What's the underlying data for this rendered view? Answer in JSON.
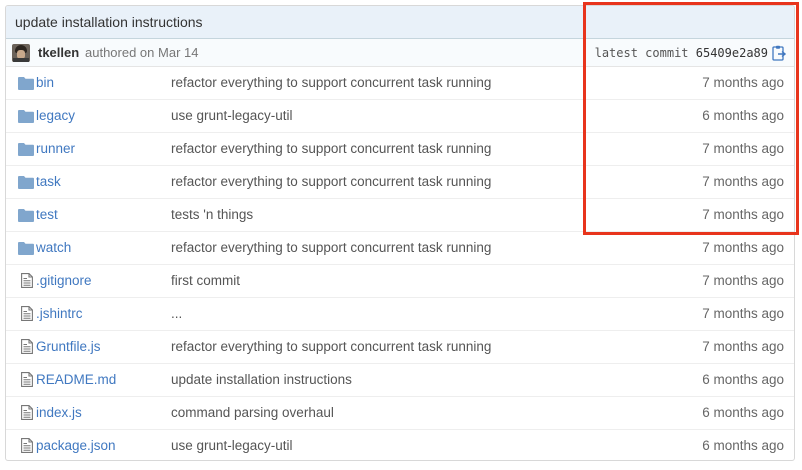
{
  "latest_commit": {
    "message": "update installation instructions",
    "author": "tkellen",
    "authored_text": "authored on Mar 14",
    "sha_label": "latest commit",
    "sha": "65409e2a89"
  },
  "files": [
    {
      "type": "folder",
      "icon": "folder-icon",
      "name": "bin",
      "message": "refactor everything to support concurrent task running",
      "age": "7 months ago"
    },
    {
      "type": "folder",
      "icon": "folder-icon",
      "name": "legacy",
      "message": "use grunt-legacy-util",
      "age": "6 months ago"
    },
    {
      "type": "folder",
      "icon": "folder-icon",
      "name": "runner",
      "message": "refactor everything to support concurrent task running",
      "age": "7 months ago"
    },
    {
      "type": "folder",
      "icon": "folder-icon",
      "name": "task",
      "message": "refactor everything to support concurrent task running",
      "age": "7 months ago"
    },
    {
      "type": "folder",
      "icon": "folder-icon",
      "name": "test",
      "message": "tests 'n things",
      "age": "7 months ago"
    },
    {
      "type": "folder",
      "icon": "folder-icon",
      "name": "watch",
      "message": "refactor everything to support concurrent task running",
      "age": "7 months ago"
    },
    {
      "type": "file",
      "icon": "file-icon",
      "name": ".gitignore",
      "message": "first commit",
      "age": "7 months ago"
    },
    {
      "type": "file",
      "icon": "file-icon",
      "name": ".jshintrc",
      "message": "...",
      "age": "7 months ago"
    },
    {
      "type": "file",
      "icon": "file-icon",
      "name": "Gruntfile.js",
      "message": "refactor everything to support concurrent task running",
      "age": "7 months ago"
    },
    {
      "type": "file",
      "icon": "file-icon",
      "name": "README.md",
      "message": "update installation instructions",
      "age": "6 months ago"
    },
    {
      "type": "file",
      "icon": "file-icon",
      "name": "index.js",
      "message": "command parsing overhaul",
      "age": "6 months ago"
    },
    {
      "type": "file",
      "icon": "file-icon",
      "name": "package.json",
      "message": "use grunt-legacy-util",
      "age": "6 months ago"
    }
  ],
  "colors": {
    "link": "#4078c0",
    "folder": "#80a6cd",
    "highlight": "#e8341c",
    "commit_bar": "#e9f1f9"
  }
}
